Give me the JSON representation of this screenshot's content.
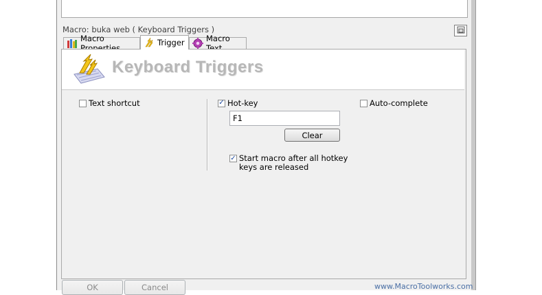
{
  "window": {
    "title": "Macro: buka web ( Keyboard Triggers )"
  },
  "tabs": [
    {
      "label": "Macro Properties",
      "icon": "macro-properties-icon",
      "active": false
    },
    {
      "label": "Trigger",
      "icon": "lightning-icon",
      "active": true
    },
    {
      "label": "Macro Text",
      "icon": "gear-icon",
      "active": false
    }
  ],
  "header": {
    "title": "Keyboard Triggers",
    "icon": "keyboard-lightning-icon"
  },
  "options": {
    "text_shortcut": {
      "label": "Text shortcut",
      "checked": false
    },
    "hot_key": {
      "label": "Hot-key",
      "checked": true,
      "value": "F1",
      "clear_label": "Clear"
    },
    "auto_complete": {
      "label": "Auto-complete",
      "checked": false
    },
    "release_option": {
      "line1": "Start macro after all hotkey",
      "line2": "keys are released",
      "checked": true
    }
  },
  "footer": {
    "ok_label": "OK",
    "cancel_label": "Cancel",
    "link": "www.MacroToolworks.com"
  },
  "colors": {
    "header_title": "#b7b7b7",
    "link": "#4a6fa5",
    "panel": "#f0f0f0"
  }
}
